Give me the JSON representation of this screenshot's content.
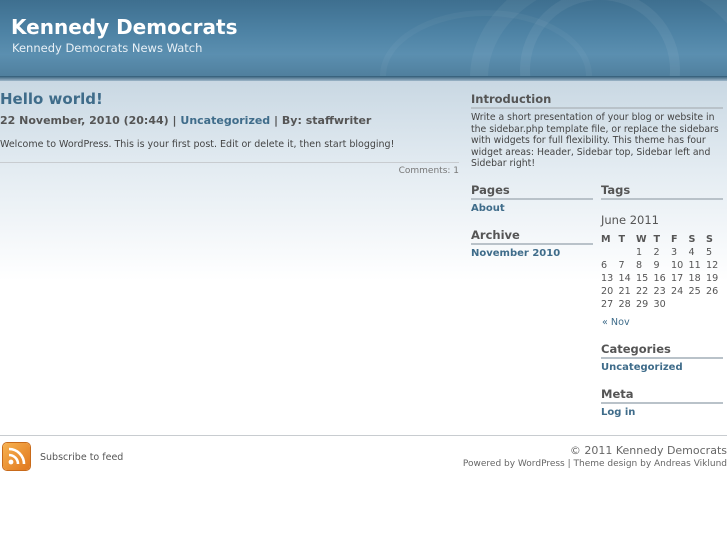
{
  "header": {
    "title": "Kennedy Democrats",
    "description": "Kennedy Democrats News Watch"
  },
  "post": {
    "title": "Hello world!",
    "date": "22 November, 2010 (20:44)",
    "separator1": "|",
    "category": "Uncategorized",
    "separator2": "|",
    "by_label": "By:",
    "author": "staffwriter",
    "body": "Welcome to WordPress. This is your first post. Edit or delete it, then start blogging!",
    "comments": "Comments: 1"
  },
  "sidebar": {
    "intro_title": "Introduction",
    "intro_text": "Write a short presentation of your blog or website in the sidebar.php template file, or replace the sidebars with widgets for full flexibility. This theme has four widget areas: Header, Sidebar top, Sidebar left and Sidebar right!",
    "pages_title": "Pages",
    "pages": [
      "About"
    ],
    "archive_title": "Archive",
    "archives": [
      "November 2010"
    ],
    "tags_title": "Tags",
    "calendar": {
      "caption": "June 2011",
      "days": [
        "M",
        "T",
        "W",
        "T",
        "F",
        "S",
        "S"
      ],
      "weeks": [
        [
          "",
          "",
          "1",
          "2",
          "3",
          "4",
          "5"
        ],
        [
          "6",
          "7",
          "8",
          "9",
          "10",
          "11",
          "12"
        ],
        [
          "13",
          "14",
          "15",
          "16",
          "17",
          "18",
          "19"
        ],
        [
          "20",
          "21",
          "22",
          "23",
          "24",
          "25",
          "26"
        ],
        [
          "27",
          "28",
          "29",
          "30",
          "",
          "",
          ""
        ]
      ],
      "prev": "« Nov"
    },
    "categories_title": "Categories",
    "categories": [
      "Uncategorized"
    ],
    "meta_title": "Meta",
    "meta": [
      "Log in"
    ]
  },
  "footer": {
    "subscribe": "Subscribe to feed",
    "copyright": "© 2011 Kennedy Democrats",
    "powered": "Powered by WordPress | Theme design by Andreas Viklund"
  },
  "colors": {
    "header_bg": "#4d82a4",
    "link": "#3f6c8a",
    "rss": "#e0771e"
  }
}
